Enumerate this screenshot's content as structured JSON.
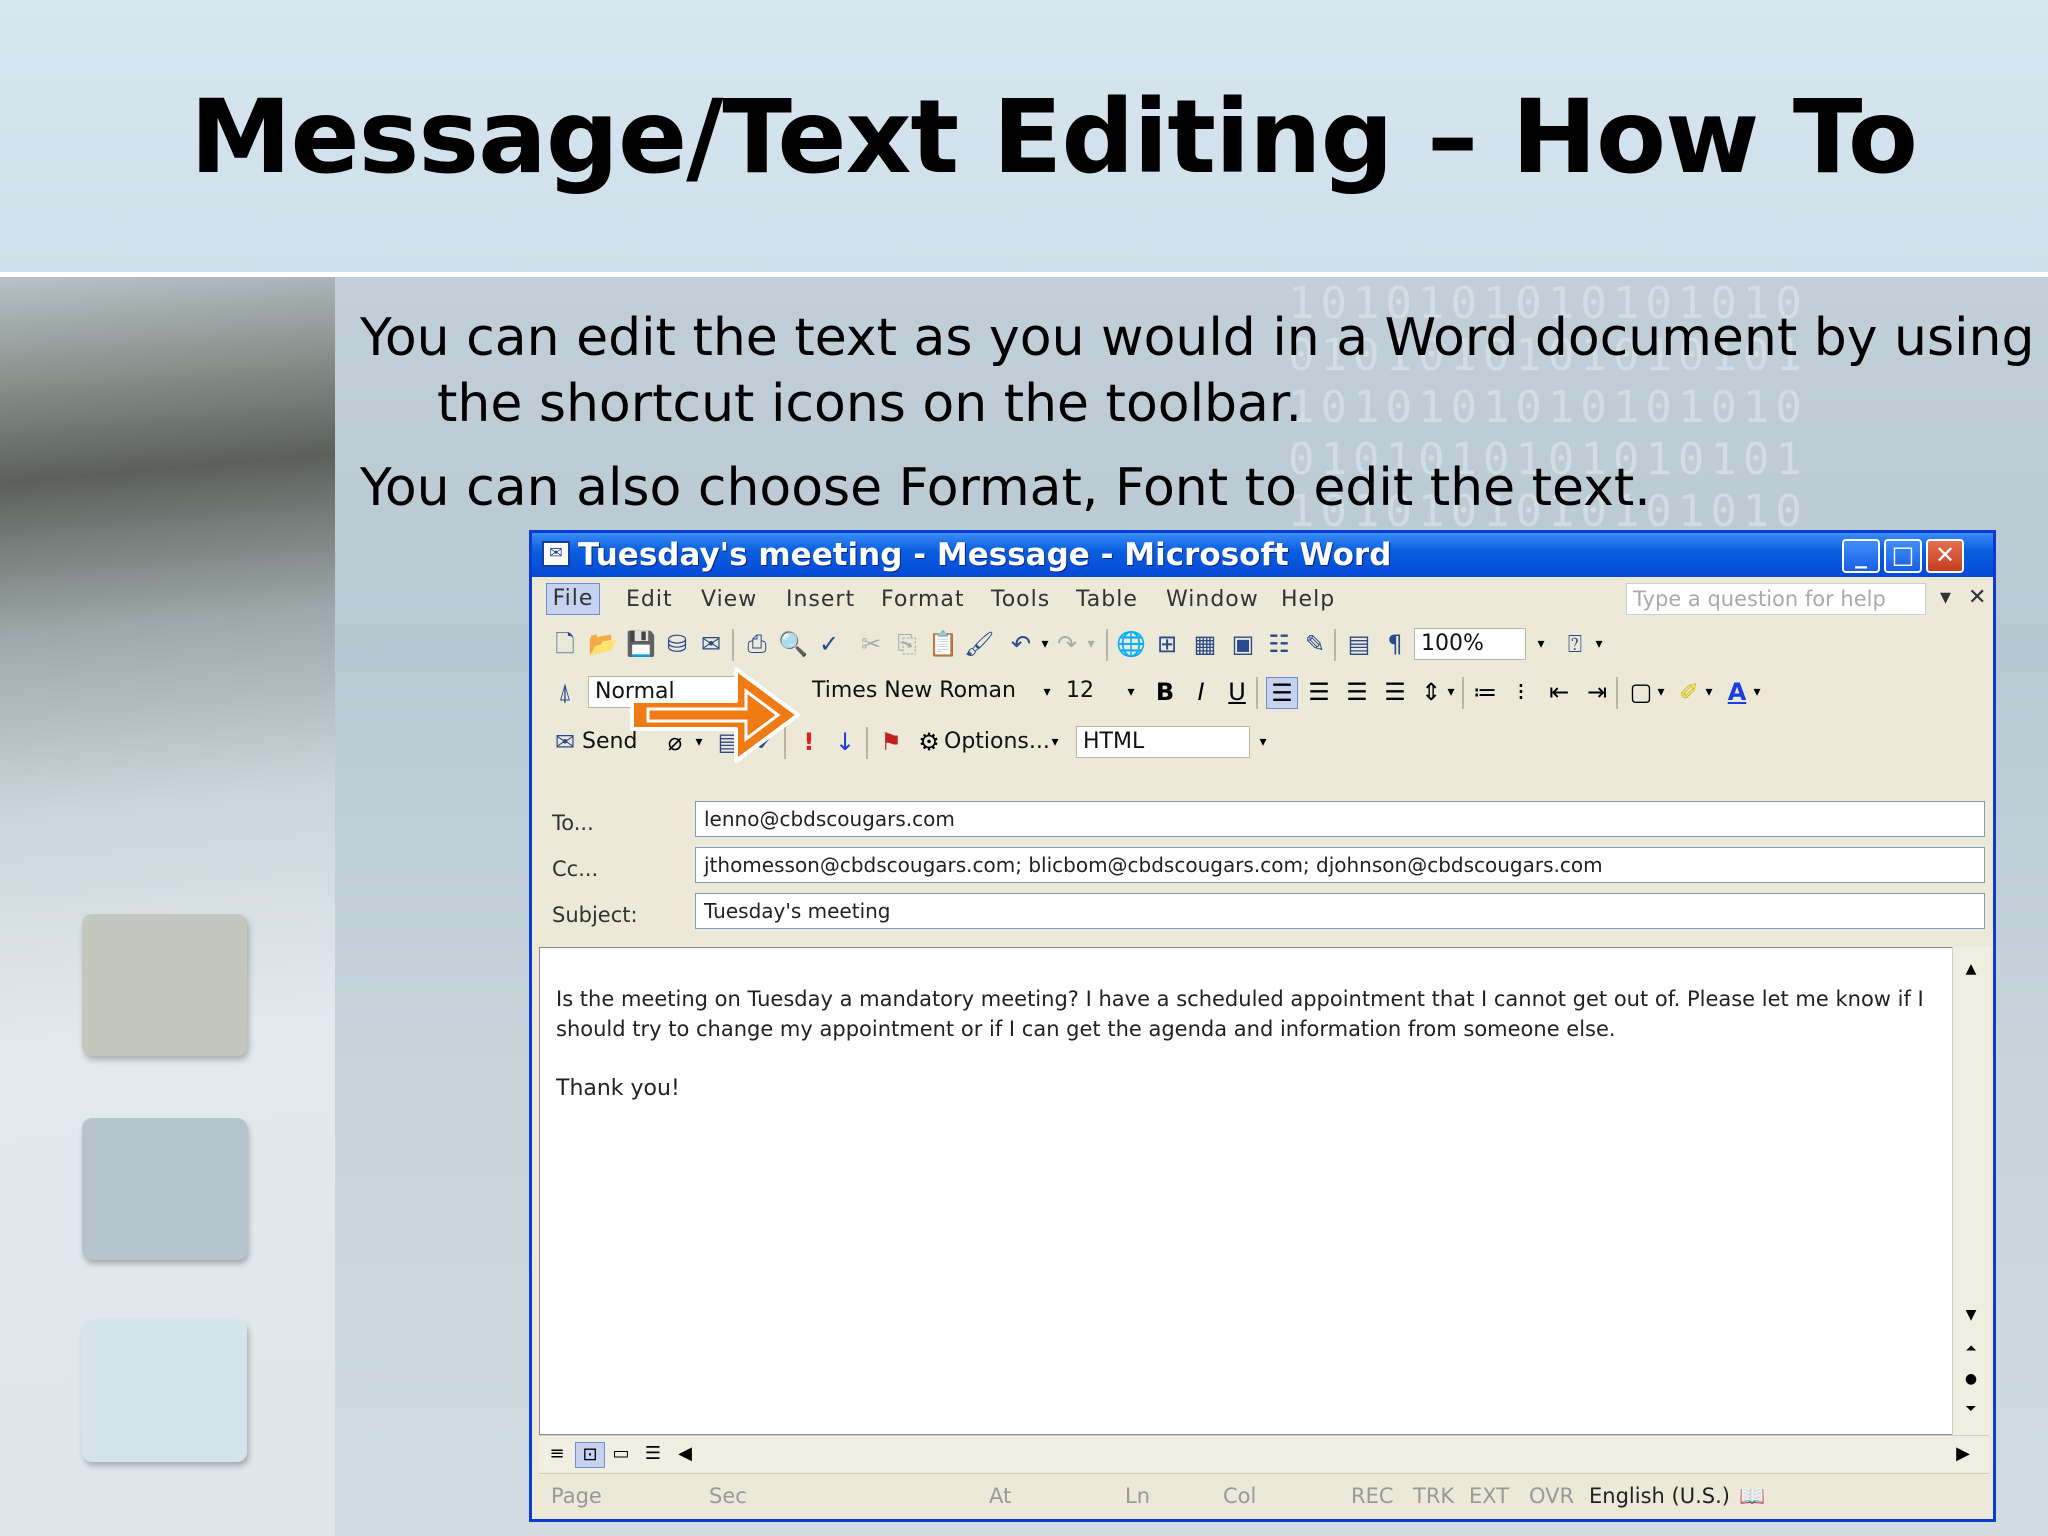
{
  "slide": {
    "title": "Message/Text Editing – How To",
    "bullet1_line1": "You can edit the text as you would in a Word document by using",
    "bullet1_line2": "the shortcut icons on the toolbar.",
    "bullet2": "You can also choose Format, Font to edit the text.",
    "binary_deco": "1010101010101010\n0101010101010101\n1010101010101010\n0101010101010101\n1010101010101010"
  },
  "window": {
    "title": "Tuesday's meeting - Message - Microsoft Word",
    "buttons": {
      "minimize": "_",
      "maximize": "□",
      "close": "✕"
    }
  },
  "menu": {
    "items": [
      "File",
      "Edit",
      "View",
      "Insert",
      "Format",
      "Tools",
      "Table",
      "Window",
      "Help"
    ],
    "help_placeholder": "Type a question for help"
  },
  "toolbar": {
    "zoom": "100%",
    "style": "Normal",
    "font": "Times New Roman",
    "size": "12",
    "send": "Send",
    "options": "Options...",
    "format": "HTML"
  },
  "header": {
    "to_label": "To...",
    "to_value": "lenno@cbdscougars.com",
    "cc_label": "Cc...",
    "cc_value": "jthomesson@cbdscougars.com; blicbom@cbdscougars.com; djohnson@cbdscougars.com",
    "subject_label": "Subject:",
    "subject_value": "Tuesday's meeting"
  },
  "body": {
    "text": "Is the meeting on Tuesday a mandatory meeting? I have a scheduled appointment that I cannot get out of. Please let me know if I should try to change my appointment or if I can get the agenda and information from someone else.",
    "thanks": "Thank you!"
  },
  "status": {
    "page": "Page",
    "sec": "Sec",
    "at": "At",
    "ln": "Ln",
    "col": "Col",
    "rec": "REC",
    "trk": "TRK",
    "ext": "EXT",
    "ovr": "OVR",
    "language": "English (U.S.)"
  },
  "colors": {
    "accent_arrow": "#f07a14",
    "titlebar": "#0a5fe0"
  }
}
